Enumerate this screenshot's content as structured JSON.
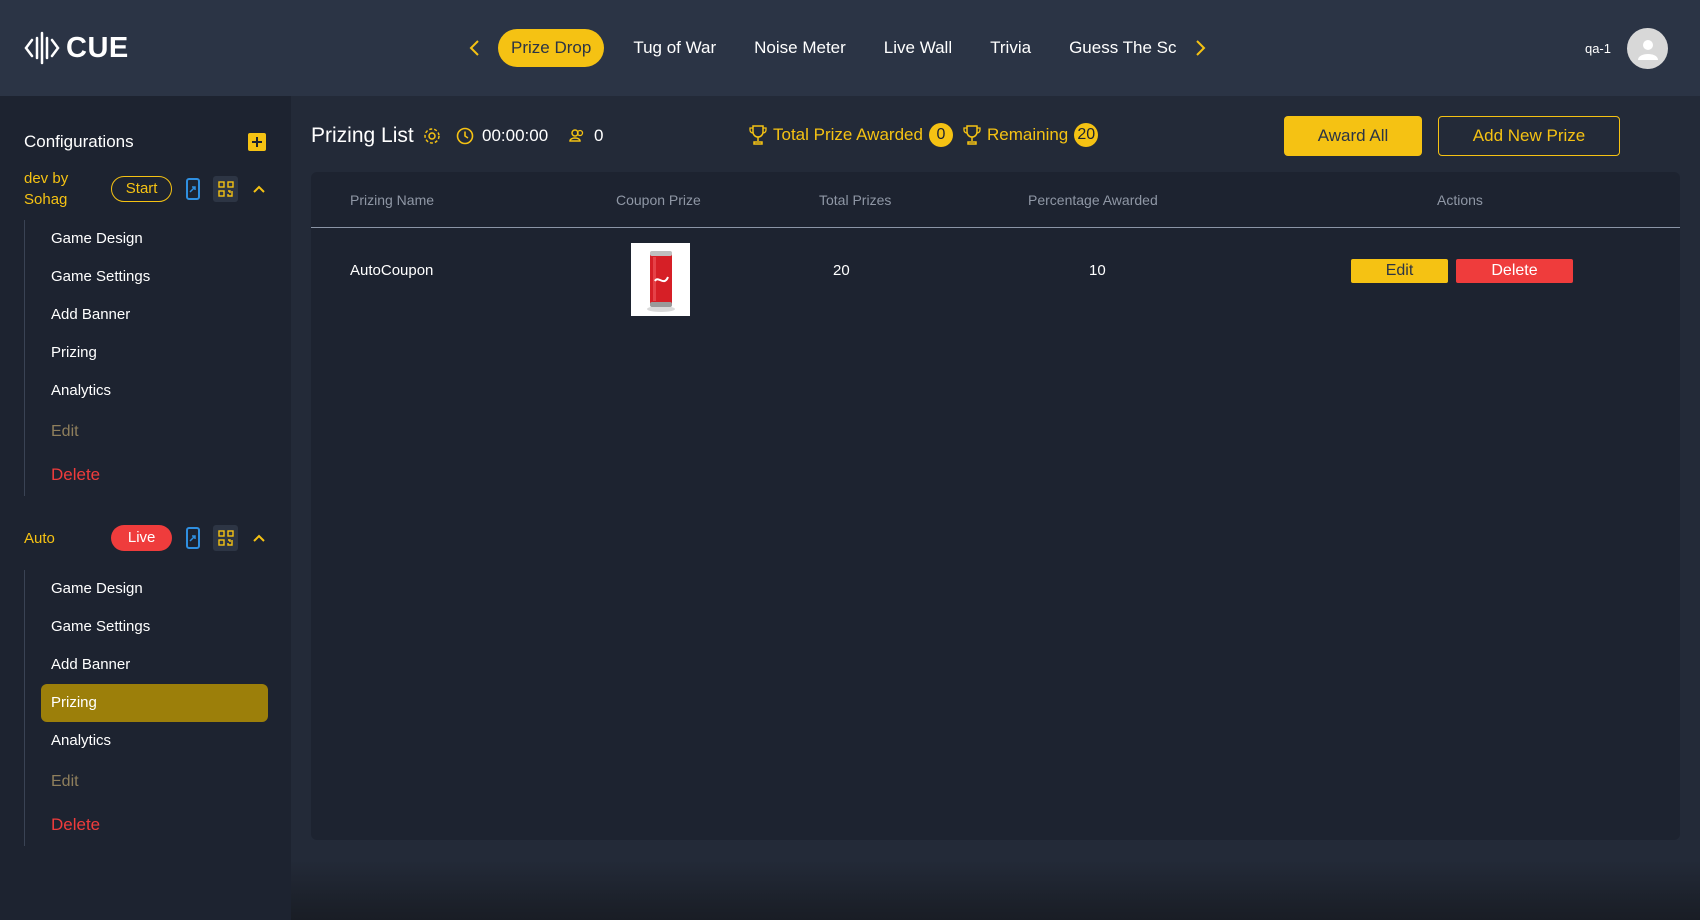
{
  "brand": {
    "logo_text": "CUE"
  },
  "colors": {
    "accent": "#f5c213",
    "danger": "#ef3c3c",
    "header_bg": "#2b3445",
    "sidebar_bg": "#1d2330",
    "body_bg": "#232a38"
  },
  "header": {
    "tabs": [
      {
        "label": "Prize Drop",
        "active": true
      },
      {
        "label": "Tug of War"
      },
      {
        "label": "Noise Meter"
      },
      {
        "label": "Live Wall"
      },
      {
        "label": "Trivia"
      },
      {
        "label": "Guess The Sc"
      }
    ],
    "username": "qa-1"
  },
  "sidebar": {
    "title": "Configurations",
    "games": [
      {
        "name": "dev by Sohag",
        "status": "Start",
        "menu": [
          "Game Design",
          "Game Settings",
          "Add Banner",
          "Prizing",
          "Analytics",
          "Edit",
          "Delete"
        ]
      },
      {
        "name": "Auto",
        "status": "Live",
        "menu": [
          "Game Design",
          "Game Settings",
          "Add Banner",
          "Prizing",
          "Analytics",
          "Edit",
          "Delete"
        ],
        "active_item": "Prizing"
      }
    ]
  },
  "main": {
    "title": "Prizing List",
    "timer": "00:00:00",
    "participants": "0",
    "total_awarded_label": "Total Prize Awarded",
    "total_awarded_count": "0",
    "remaining_label": "Remaining",
    "remaining_count": "20",
    "award_all_label": "Award All",
    "add_prize_label": "Add New Prize",
    "table": {
      "headers": [
        "Prizing Name",
        "Coupon Prize",
        "Total Prizes",
        "Percentage Awarded",
        "Actions"
      ],
      "rows": [
        {
          "name": "AutoCoupon",
          "coupon": "cola-can-image",
          "total": "20",
          "percentage": "10",
          "edit": "Edit",
          "delete": "Delete"
        }
      ]
    }
  }
}
